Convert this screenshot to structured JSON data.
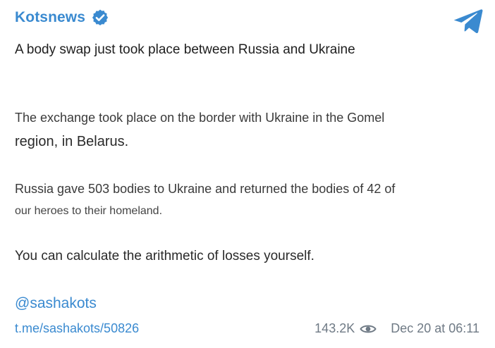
{
  "post": {
    "channel_name": "Kotsnews",
    "paragraph1": "A body swap just took place between Russia and Ukraine",
    "paragraph2_line1": "The exchange took place on the border with Ukraine in the Gomel",
    "paragraph2_line2": "region, in Belarus.",
    "paragraph3_line1": "Russia gave 503 bodies to Ukraine and returned the bodies of 42 of",
    "paragraph3_line2": "our heroes to their homeland.",
    "paragraph4": "You can calculate the arithmetic of losses yourself.",
    "mention": "@sashakots",
    "link": "t.me/sashakots/50826",
    "views": "143.2K",
    "date": "Dec 20 at 06:11"
  },
  "colors": {
    "accent": "#3a8ad0",
    "meta": "#6f7a85"
  },
  "icons": {
    "verified": "verified-badge-icon",
    "telegram": "telegram-plane-icon",
    "views": "eye-icon"
  }
}
